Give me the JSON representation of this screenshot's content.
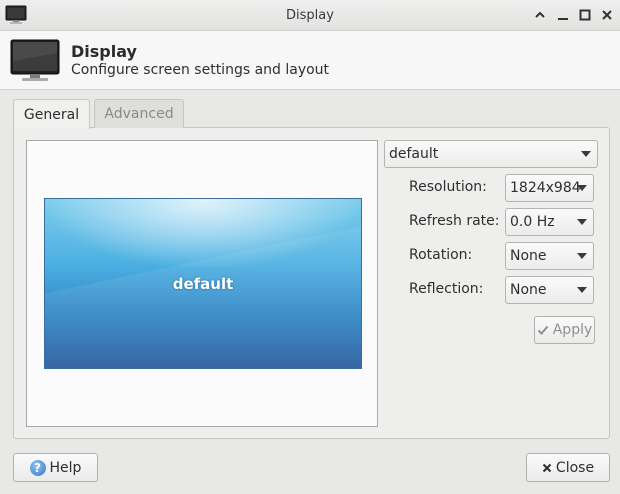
{
  "window": {
    "title": "Display",
    "controls": {
      "shade_icon": "chevron-up-icon",
      "minimize_icon": "minimize-icon",
      "maximize_icon": "maximize-icon",
      "close_icon": "close-icon"
    }
  },
  "header": {
    "title": "Display",
    "subtitle": "Configure screen settings and layout",
    "icon": "monitor-icon"
  },
  "tabs": [
    {
      "label": "General",
      "active": true
    },
    {
      "label": "Advanced",
      "active": false
    }
  ],
  "preview": {
    "monitor_label": "default"
  },
  "settings": {
    "output_select": "default",
    "resolution": {
      "label": "Resolution:",
      "value": "1824x984"
    },
    "refresh_rate": {
      "label": "Refresh rate:",
      "value": "0.0 Hz"
    },
    "rotation": {
      "label": "Rotation:",
      "value": "None"
    },
    "reflection": {
      "label": "Reflection:",
      "value": "None"
    },
    "apply_label": "Apply",
    "apply_icon": "checkmark-icon"
  },
  "footer": {
    "help_label": "Help",
    "help_icon_glyph": "?",
    "close_label": "Close",
    "close_icon": "close-icon"
  },
  "colors": {
    "monitor_top": "#7fcdec",
    "monitor_bottom": "#265a9c"
  }
}
